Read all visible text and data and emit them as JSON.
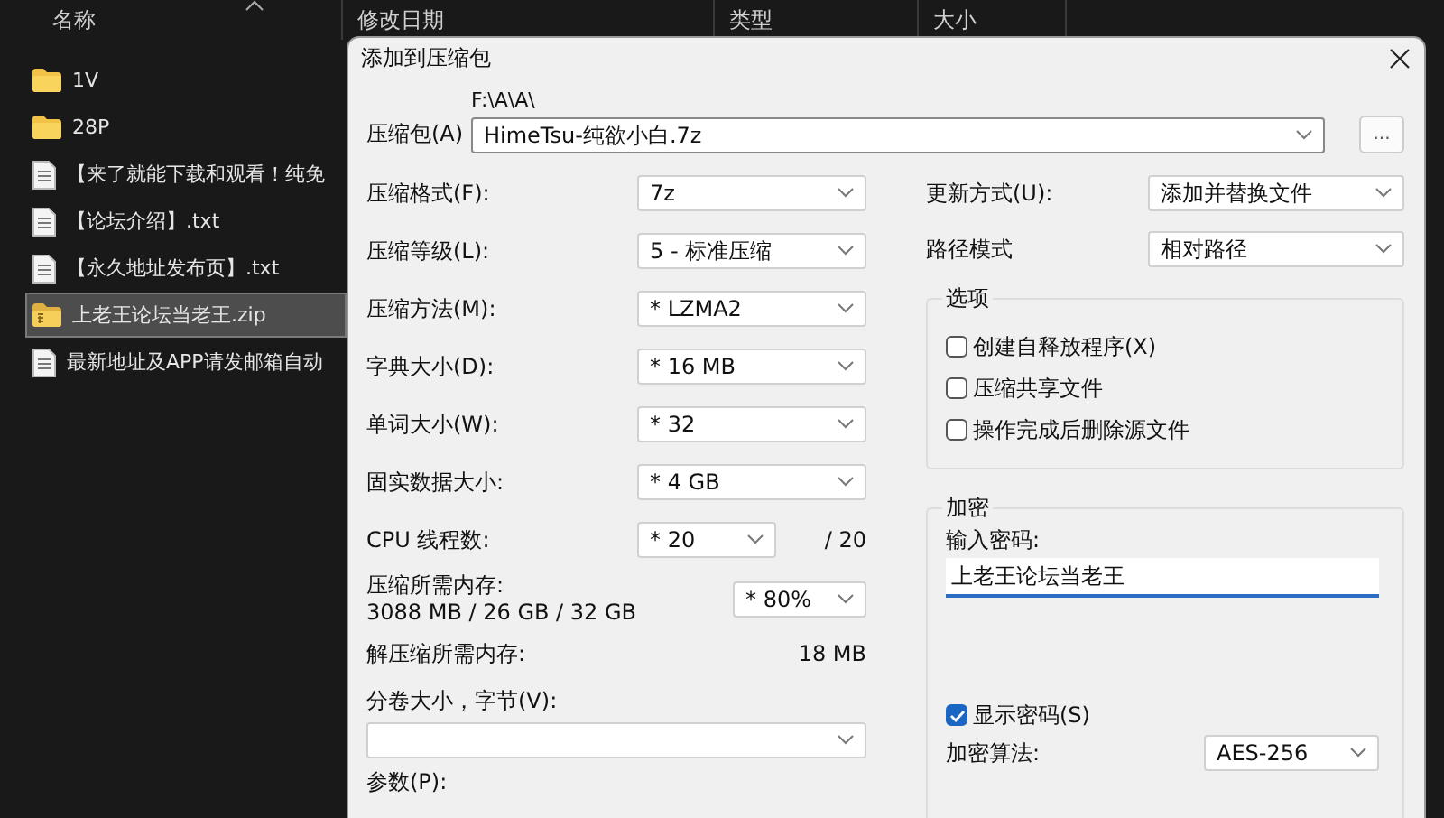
{
  "explorer": {
    "columns": [
      "名称",
      "修改日期",
      "类型",
      "大小"
    ],
    "files": [
      {
        "name": "1V",
        "kind": "folder",
        "selected": false
      },
      {
        "name": "28P",
        "kind": "folder",
        "selected": false
      },
      {
        "name": "【来了就能下载和观看！纯免",
        "kind": "text",
        "selected": false
      },
      {
        "name": "【论坛介绍】.txt",
        "kind": "text",
        "selected": false
      },
      {
        "name": "【永久地址发布页】.txt",
        "kind": "text",
        "selected": false
      },
      {
        "name": "上老王论坛当老王.zip",
        "kind": "zip",
        "selected": true
      },
      {
        "name": "最新地址及APP请发邮箱自动",
        "kind": "text",
        "selected": false
      }
    ]
  },
  "dialog": {
    "title": "添加到压缩包",
    "archive": {
      "label": "压缩包(A)",
      "path": "F:\\A\\A\\",
      "value": "HimeTsu-纯欲小白.7z"
    },
    "browse": "...",
    "settings": [
      {
        "label": "压缩格式(F):",
        "value": "7z"
      },
      {
        "label": "压缩等级(L):",
        "value": "5 - 标准压缩"
      },
      {
        "label": "压缩方法(M):",
        "value": "* LZMA2"
      },
      {
        "label": "字典大小(D):",
        "value": "* 16 MB"
      },
      {
        "label": "单词大小(W):",
        "value": "* 32"
      },
      {
        "label": "固实数据大小:",
        "value": "* 4 GB"
      },
      {
        "label": "CPU 线程数:",
        "value": "* 20",
        "suffix": "/ 20"
      }
    ],
    "memory": {
      "label": "压缩所需内存:",
      "detail": "3088 MB / 26 GB / 32 GB",
      "value": "* 80%"
    },
    "decompress": {
      "label": "解压缩所需内存:",
      "value": "18 MB"
    },
    "volume": {
      "label": "分卷大小，字节(V):"
    },
    "params": {
      "label": "参数(P):"
    },
    "update": {
      "label": "更新方式(U):",
      "value": "添加并替换文件"
    },
    "path_mode": {
      "label": "路径模式",
      "value": "相对路径"
    },
    "options": {
      "title": "选项",
      "items": [
        {
          "label": "创建自释放程序(X)",
          "checked": false
        },
        {
          "label": "压缩共享文件",
          "checked": false
        },
        {
          "label": "操作完成后删除源文件",
          "checked": false
        }
      ]
    },
    "encryption": {
      "title": "加密",
      "password_label": "输入密码:",
      "password": "上老王论坛当老王",
      "show_password": {
        "label": "显示密码(S)",
        "checked": true
      },
      "method": {
        "label": "加密算法:",
        "value": "AES-256"
      }
    }
  }
}
